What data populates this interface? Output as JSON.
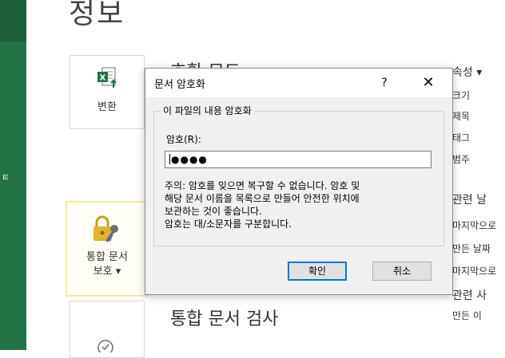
{
  "page": {
    "title": "정보"
  },
  "tiles": {
    "convert_label": "변환",
    "protect_label_1": "통합 문서",
    "protect_label_2": "보호 ▾"
  },
  "sections": {
    "compat_title": "호환 모드",
    "inspect_title": "통합 문서 검사"
  },
  "properties": {
    "header": "속성 ▾",
    "items": [
      "크기",
      "제목",
      "태그",
      "범주"
    ],
    "related_dates": "관련 날",
    "dates": [
      "마지막으로",
      "만든 날짜",
      "마지막으로"
    ],
    "related_people": "관련 사",
    "creator": "만든 이"
  },
  "dialog": {
    "title": "문서 암호화",
    "help": "?",
    "close": "✕",
    "group_label": "이 파일의 내용 암호화",
    "password_label": "암호(R):",
    "password_value": "●●●●",
    "note_lines": [
      "주의: 암호를 잊으면 복구할 수 없습니다. 암호 및",
      "해당 문서 이름을 목록으로 만들어 안전한 위치에",
      "보관하는 것이 좋습니다.",
      "암호는 대/소문자를 구분합니다."
    ],
    "ok_label": "확인",
    "cancel_label": "취소"
  },
  "colors": {
    "excel_green": "#217346",
    "accent": "#0078d7",
    "protect_highlight": "#f8e9a1"
  }
}
